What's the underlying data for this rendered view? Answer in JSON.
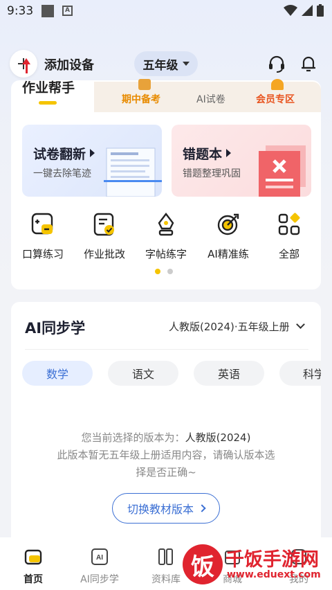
{
  "status_bar": {
    "time": "9:33",
    "app_badge": "A"
  },
  "header": {
    "add_device_label": "添加设备",
    "grade": "五年级"
  },
  "tabs": {
    "main": "作业帮手",
    "items": [
      "期中备考",
      "AI试卷",
      "会员专区"
    ]
  },
  "feature_cards": [
    {
      "title": "试卷翻新",
      "subtitle": "一键去除笔迹"
    },
    {
      "title": "错题本",
      "subtitle": "错题整理巩固"
    }
  ],
  "tools": [
    "口算练习",
    "作业批改",
    "字帖练字",
    "AI精准练",
    "全部"
  ],
  "sync": {
    "title": "AI同步学",
    "version": "人教版(2024)·五年级上册",
    "subjects": [
      "数学",
      "语文",
      "英语",
      "科学"
    ],
    "message_prefix": "您当前选择的版本为：",
    "message_version": "人教版(2024)",
    "message_line2": "此版本暂无五年级上册适用内容，请确认版本选",
    "message_line3": "择是否正确~",
    "switch_button": "切换教材版本"
  },
  "bottom_nav": [
    "首页",
    "AI同步学",
    "资料库",
    "商城",
    "我的"
  ],
  "watermark": {
    "glyph": "饭",
    "title": "千饭手游网",
    "url": "www.eduext.com"
  },
  "colors": {
    "accent": "#3b6fd4",
    "yellow": "#f5c400",
    "red": "#e0242f"
  }
}
